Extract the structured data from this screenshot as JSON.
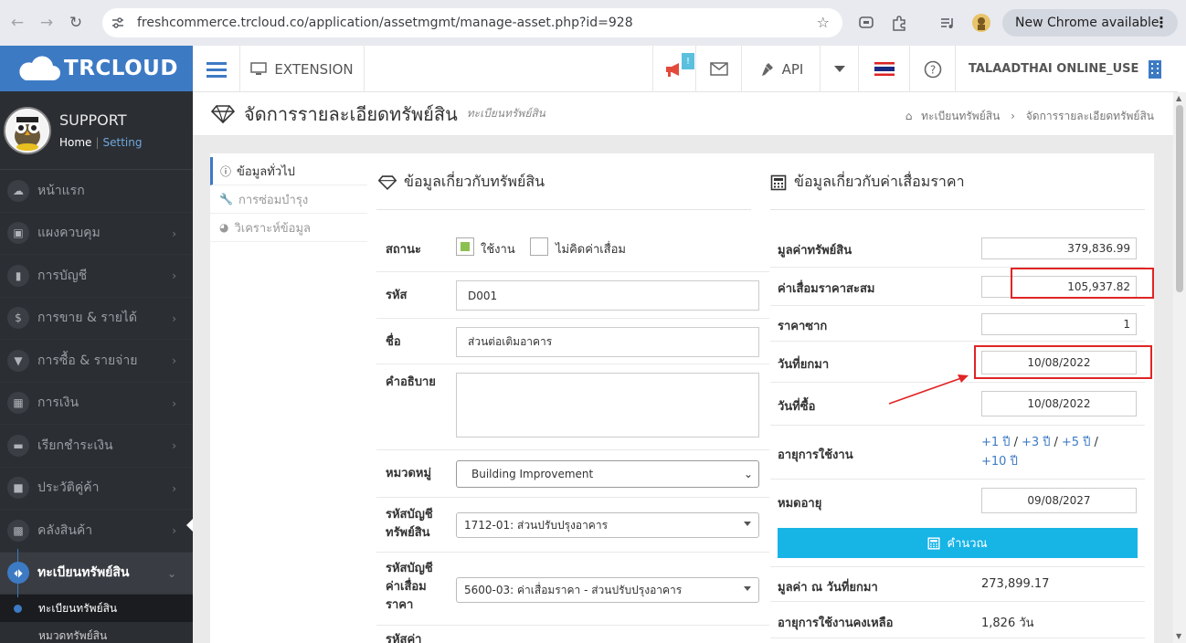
{
  "browser": {
    "url": "freshcommerce.trcloud.co/application/assetmgmt/manage-asset.php?id=928",
    "new_chrome": "New Chrome available"
  },
  "sidebar": {
    "logo": "TRCLOUD",
    "user": "SUPPORT",
    "home_link": "Home",
    "setting_link": "Setting",
    "items": [
      {
        "label": "หน้าแรก",
        "icon": "cloud-icon"
      },
      {
        "label": "แผงควบคุม",
        "icon": "monitor-icon"
      },
      {
        "label": "การบัญชี",
        "icon": "book-icon"
      },
      {
        "label": "การขาย & รายได้",
        "icon": "dollar-icon"
      },
      {
        "label": "การซื้อ & รายจ่าย",
        "icon": "cart-icon"
      },
      {
        "label": "การเงิน",
        "icon": "calendar-icon"
      },
      {
        "label": "เรียกชำระเงิน",
        "icon": "credit-card-icon"
      },
      {
        "label": "ประวัติคู่ค้า",
        "icon": "address-book-icon"
      },
      {
        "label": "คลังสินค้า",
        "icon": "cubes-icon"
      },
      {
        "label": "ทะเบียนทรัพย์สิน",
        "icon": "diamond-icon"
      }
    ],
    "sub_items": [
      "ทะเบียนทรัพย์สิน",
      "หมวดทรัพย์สิน"
    ]
  },
  "topnav": {
    "extension": "EXTENSION",
    "api": "API",
    "badge": "!",
    "company": "TALAADTHAI ONLINE_USE"
  },
  "page": {
    "title": "จัดการรายละเอียดทรัพย์สิน",
    "subtitle": "ทะเบียนทรัพย์สิน",
    "breadcrumb": [
      "ทะเบียนทรัพย์สิน",
      "จัดการรายละเอียดทรัพย์สิน"
    ]
  },
  "tabs": [
    "ข้อมูลทั่วไป",
    "การซ่อมบำรุง",
    "วิเคราะห์ข้อมูล"
  ],
  "asset_info": {
    "title": "ข้อมูลเกี่ยวกับทรัพย์สิน",
    "status_label": "สถานะ",
    "status_active": "ใช้งาน",
    "status_no_dep": "ไม่คิดค่าเสื่อม",
    "code_label": "รหัส",
    "code": "D001",
    "name_label": "ชื่อ",
    "name": "ส่วนต่อเติมอาคาร",
    "desc_label": "คำอธิบาย",
    "desc": "",
    "category_label": "หมวดหมู่",
    "category": "Building Improvement",
    "asset_acc_label": [
      "รหัสบัญชี",
      "ทรัพย์สิน"
    ],
    "asset_acc": "1712-01: ส่วนปรับปรุงอาคาร",
    "dep_acc_label": [
      "รหัสบัญชี",
      "ค่าเสื่อม",
      "ราคา"
    ],
    "dep_acc": "5600-03: ค่าเสื่อมราคา - ส่วนปรับปรุงอาคาร",
    "next_label": "รหัสค่า"
  },
  "depreciation": {
    "title": "ข้อมูลเกี่ยวกับค่าเสื่อมราคา",
    "asset_value_label": "มูลค่าทรัพย์สิน",
    "asset_value": "379,836.99",
    "acc_dep_label": "ค่าเสื่อมราคาสะสม",
    "acc_dep": "105,937.82",
    "salvage_label": "ราคาซาก",
    "salvage": "1",
    "carry_label": "วันที่ยกมา",
    "carry_date": "10/08/2022",
    "buy_label": "วันที่ซื้อ",
    "buy_date": "10/08/2022",
    "life_label": "อายุการใช้งาน",
    "life_options": [
      "+1 ปี",
      "+3 ปี",
      "+5 ปี",
      "+10 ปี"
    ],
    "expire_label": "หมดอายุ",
    "expire_date": "09/08/2027",
    "calc_button": "คำนวณ",
    "value_at_carry_label": "มูลค่า ณ วันที่ยกมา",
    "value_at_carry": "273,899.17",
    "remain_label": "อายุการใช้งานคงเหลือ",
    "remain": "1,826 วัน"
  },
  "colors": {
    "brand": "#3d7ac4",
    "sidebar": "#2b2e33",
    "calc": "#17b4e6",
    "annotation": "#e02424"
  }
}
